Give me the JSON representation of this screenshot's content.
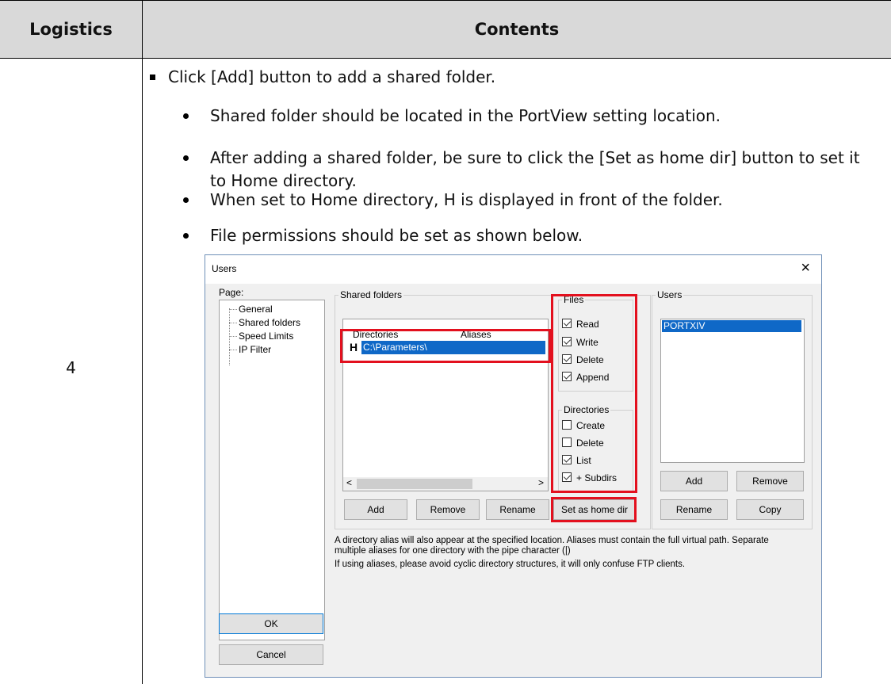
{
  "table": {
    "header_col1": "Logistics",
    "header_col2": "Contents",
    "row_number": "4"
  },
  "bullets": {
    "main": "Click [Add] button to add a shared folder.",
    "items": [
      "Shared folder should be located in the PortView setting location.",
      "After adding a shared folder, be sure to click the [Set as home dir] button to set it to Home directory.",
      "When set to Home directory, H is displayed in front of the folder.",
      "File permissions should be set as shown below."
    ]
  },
  "dialog": {
    "title": "Users",
    "close_glyph": "×",
    "page_label": "Page:",
    "pages": [
      "General",
      "Shared folders",
      "Speed Limits",
      "IP Filter"
    ],
    "shared_folders_title": "Shared folders",
    "col_directories": "Directories",
    "col_aliases": "Aliases",
    "home_marker": "H",
    "folder_path": "C:\\Parameters\\",
    "scroll_left": "<",
    "scroll_right": ">",
    "btn_add": "Add",
    "btn_remove": "Remove",
    "btn_rename": "Rename",
    "btn_set_home": "Set as home dir",
    "files_title": "Files",
    "files": [
      {
        "label": "Read",
        "checked": true
      },
      {
        "label": "Write",
        "checked": true
      },
      {
        "label": "Delete",
        "checked": true
      },
      {
        "label": "Append",
        "checked": true
      }
    ],
    "directories_title": "Directories",
    "directories": [
      {
        "label": "Create",
        "checked": false
      },
      {
        "label": "Delete",
        "checked": false
      },
      {
        "label": "List",
        "checked": true
      },
      {
        "label": "+ Subdirs",
        "checked": true
      }
    ],
    "users_title": "Users",
    "users": [
      "PORTXIV"
    ],
    "btn_users_add": "Add",
    "btn_users_remove": "Remove",
    "btn_users_rename": "Rename",
    "btn_users_copy": "Copy",
    "note1": "A directory alias will also appear at the specified location. Aliases must contain the full virtual path. Separate multiple aliases for one directory with the pipe character (|)",
    "note2": "If using aliases, please avoid cyclic directory structures, it will only confuse FTP clients.",
    "btn_ok": "OK",
    "btn_cancel": "Cancel"
  },
  "colors": {
    "highlight_red": "#e3101e",
    "selection_blue": "#0f68c7",
    "header_gray": "#d9d9d9"
  }
}
